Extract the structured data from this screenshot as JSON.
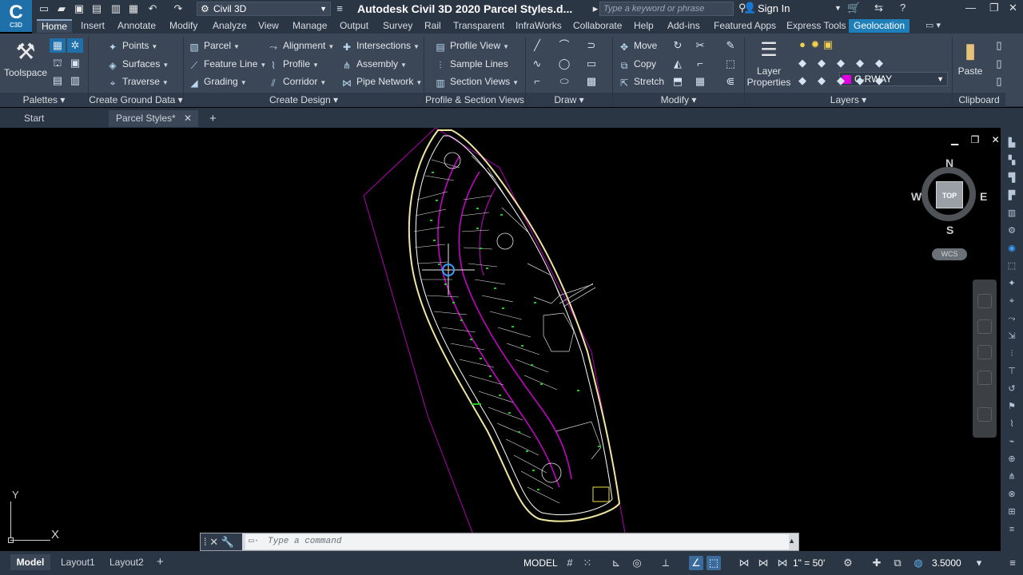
{
  "app": {
    "logo_text": "C",
    "logo_sub": "C3D",
    "title": "Autodesk Civil 3D 2020   Parcel Styles.d...",
    "workspace": "Civil 3D",
    "search_placeholder": "Type a keyword or phrase",
    "sign_in": "Sign In"
  },
  "ribbon_tabs": [
    "Home",
    "Insert",
    "Annotate",
    "Modify",
    "Analyze",
    "View",
    "Manage",
    "Output",
    "Survey",
    "Rail",
    "Transparent",
    "InfraWorks",
    "Collaborate",
    "Help",
    "Add-ins",
    "Featured Apps",
    "Express Tools",
    "Geolocation"
  ],
  "ribbon": {
    "toolspace": "Toolspace",
    "ground": {
      "points": "Points",
      "surfaces": "Surfaces",
      "traverse": "Traverse"
    },
    "design1": {
      "parcel": "Parcel",
      "feature_line": "Feature Line",
      "grading": "Grading"
    },
    "design2": {
      "alignment": "Alignment",
      "profile": "Profile",
      "corridor": "Corridor"
    },
    "design3": {
      "intersections": "Intersections",
      "assembly": "Assembly",
      "pipe_network": "Pipe Network"
    },
    "views": {
      "profile_view": "Profile View",
      "sample_lines": "Sample Lines",
      "section_views": "Section Views"
    },
    "modify": {
      "move": "Move",
      "copy": "Copy",
      "stretch": "Stretch"
    },
    "layer_properties": "Layer Properties",
    "current_layer": "C-RWAY",
    "current_layer_color": "#e000e0",
    "paste": "Paste",
    "panels": {
      "palettes": "Palettes",
      "create_ground_data": "Create Ground Data",
      "create_design": "Create Design",
      "profile_section_views": "Profile & Section Views",
      "draw": "Draw",
      "modify": "Modify",
      "layers": "Layers",
      "clipboard": "Clipboard"
    }
  },
  "doc_tabs": {
    "start": "Start",
    "current": "Parcel Styles*"
  },
  "viewcube": {
    "n": "N",
    "s": "S",
    "e": "E",
    "w": "W",
    "top": "TOP",
    "wcs": "WCS"
  },
  "ucs": {
    "x": "X",
    "y": "Y"
  },
  "command": {
    "placeholder": "Type a command"
  },
  "layout_tabs": [
    "Model",
    "Layout1",
    "Layout2"
  ],
  "status": {
    "model": "MODEL",
    "scale": "1\" = 50'",
    "lineweight": "3.5000"
  },
  "colors": {
    "accent": "#1f7fb8",
    "boundary": "#c000c0",
    "parcel_lines": "#ffffff",
    "labels": "#22c822"
  }
}
